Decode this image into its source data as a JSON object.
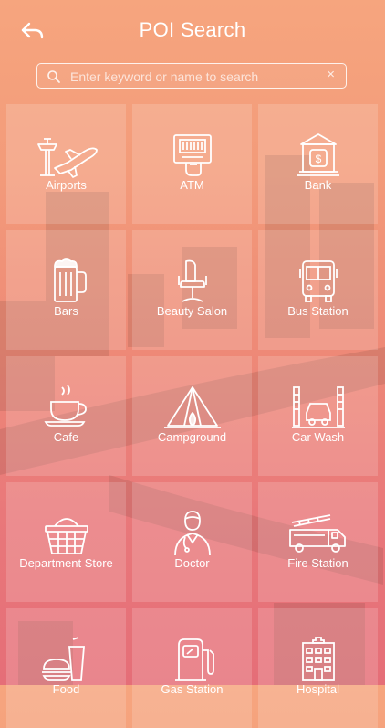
{
  "header": {
    "title": "POI Search",
    "back_icon": "back-arrow-icon"
  },
  "search": {
    "placeholder": "Enter keyword or name to search",
    "value": "",
    "clear_label": "×"
  },
  "categories": [
    {
      "label": "Airports",
      "icon": "airport-icon"
    },
    {
      "label": "ATM",
      "icon": "atm-icon"
    },
    {
      "label": "Bank",
      "icon": "bank-icon"
    },
    {
      "label": "Bars",
      "icon": "beer-mug-icon"
    },
    {
      "label": "Beauty Salon",
      "icon": "salon-chair-icon"
    },
    {
      "label": "Bus Station",
      "icon": "bus-icon"
    },
    {
      "label": "Cafe",
      "icon": "coffee-cup-icon"
    },
    {
      "label": "Campground",
      "icon": "tent-icon"
    },
    {
      "label": "Car Wash",
      "icon": "car-wash-icon"
    },
    {
      "label": "Department Store",
      "icon": "shopping-basket-icon"
    },
    {
      "label": "Doctor",
      "icon": "doctor-icon"
    },
    {
      "label": "Fire Station",
      "icon": "fire-truck-icon"
    },
    {
      "label": "Food",
      "icon": "fast-food-icon"
    },
    {
      "label": "Gas Station",
      "icon": "fuel-pump-icon"
    },
    {
      "label": "Hospital",
      "icon": "hospital-icon"
    }
  ]
}
